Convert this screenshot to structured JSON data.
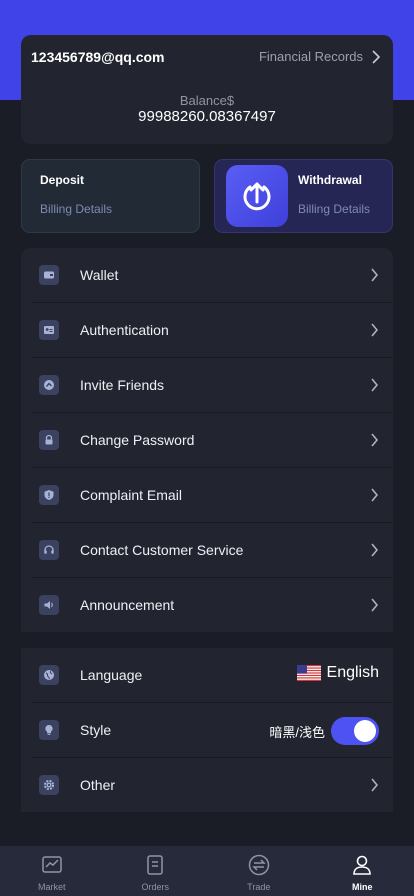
{
  "account": {
    "email": "123456789@qq.com",
    "records_label": "Financial Records",
    "balance_label": "Balance$",
    "balance_value": "99988260.08367497"
  },
  "actions": {
    "deposit": {
      "title": "Deposit",
      "subtitle": "Billing Details"
    },
    "withdraw": {
      "title": "Withdrawal",
      "subtitle": "Billing Details",
      "icon": "upload-circle-icon"
    }
  },
  "menu": {
    "items": [
      {
        "label": "Wallet",
        "icon": "wallet-icon"
      },
      {
        "label": "Authentication",
        "icon": "id-card-icon"
      },
      {
        "label": "Invite Friends",
        "icon": "share-icon"
      },
      {
        "label": "Change Password",
        "icon": "lock-icon"
      },
      {
        "label": "Complaint Email",
        "icon": "shield-alert-icon"
      },
      {
        "label": "Contact Customer Service",
        "icon": "headset-icon"
      },
      {
        "label": "Announcement",
        "icon": "speaker-icon"
      }
    ]
  },
  "settings": {
    "language": {
      "label": "Language",
      "value": "English",
      "icon": "globe-icon",
      "flag": "us-flag-icon"
    },
    "style": {
      "label": "Style",
      "value": "暗黑/浅色",
      "icon": "bulb-icon",
      "toggle_on": true
    },
    "other": {
      "label": "Other",
      "icon": "gear-icon"
    }
  },
  "tabs": [
    {
      "label": "Market",
      "icon": "chart-icon",
      "active": false
    },
    {
      "label": "Orders",
      "icon": "document-icon",
      "active": false
    },
    {
      "label": "Trade",
      "icon": "swap-icon",
      "active": false
    },
    {
      "label": "Mine",
      "icon": "user-icon",
      "active": true
    }
  ],
  "colors": {
    "accent": "#3f43e8",
    "background": "#1a1d25",
    "card": "#22252f",
    "toggle": "#4e52f2"
  }
}
